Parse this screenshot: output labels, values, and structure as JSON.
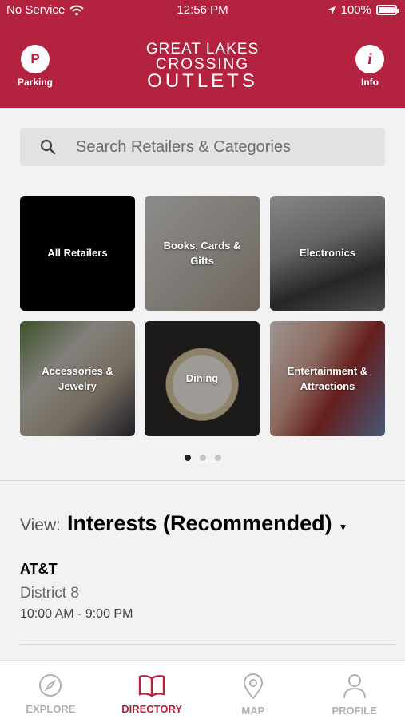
{
  "status_bar": {
    "carrier": "No Service",
    "time": "12:56 PM",
    "battery": "100%"
  },
  "header": {
    "parking_label": "Parking",
    "parking_glyph": "P",
    "info_label": "Info",
    "info_glyph": "i",
    "logo_line1": "GREAT LAKES",
    "logo_line2": "CROSSING",
    "logo_line3": "OUTLETS",
    "brand_color": "#b3233f"
  },
  "search": {
    "placeholder": "Search Retailers & Categories"
  },
  "categories": [
    {
      "label": "All Retailers"
    },
    {
      "label": "Books, Cards & Gifts"
    },
    {
      "label": "Electronics"
    },
    {
      "label": "Accessories & Jewelry"
    },
    {
      "label": "Dining"
    },
    {
      "label": "Entertainment & Attractions"
    }
  ],
  "pager": {
    "pages": 3,
    "current": 1
  },
  "view": {
    "label": "View:",
    "selected": "Interests (Recommended)"
  },
  "store": {
    "name": "AT&T",
    "location": "District 8",
    "hours": "10:00 AM - 9:00 PM"
  },
  "tabs": [
    {
      "label": "EXPLORE",
      "icon": "compass-icon"
    },
    {
      "label": "DIRECTORY",
      "icon": "book-icon"
    },
    {
      "label": "MAP",
      "icon": "map-pin-icon"
    },
    {
      "label": "PROFILE",
      "icon": "person-icon"
    }
  ]
}
